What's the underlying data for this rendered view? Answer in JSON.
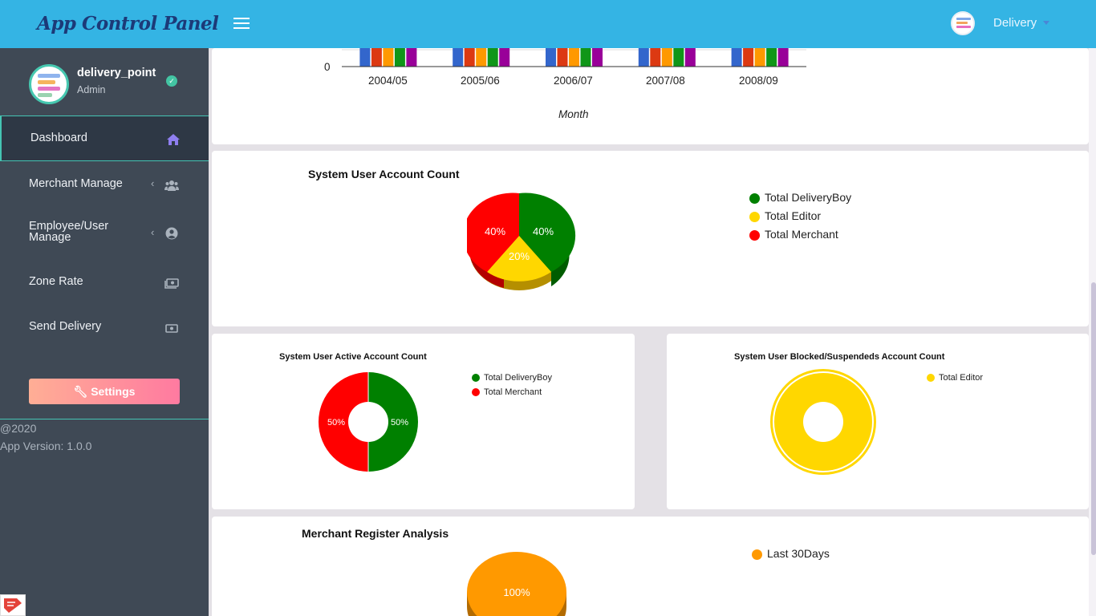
{
  "app": {
    "brand": "App Control Panel"
  },
  "header": {
    "user_name": "Delivery"
  },
  "profile": {
    "name": "delivery_point",
    "role": "Admin"
  },
  "sidebar": {
    "items": [
      {
        "label": "Dashboard",
        "icon": "home-icon",
        "active": true
      },
      {
        "label": "Merchant Manage",
        "icon": "users-icon",
        "expandable": true
      },
      {
        "label": "Employee/User Manage",
        "icon": "user-circle-icon",
        "expandable": true
      },
      {
        "label": "Zone Rate",
        "icon": "money-icon"
      },
      {
        "label": "Send Delivery",
        "icon": "money-icon"
      }
    ],
    "settings_label": "Settings",
    "settings_icon": "wrench-icon",
    "copyright": "@2020",
    "version": "App Version: 1.0.0"
  },
  "colors": {
    "topbar": "#34b4e4",
    "sidebar": "#3f4955",
    "accent_teal": "#45c4b3",
    "green": "#008000",
    "yellow": "#ffd700",
    "red": "#ff0000",
    "orange": "#ff9900"
  },
  "chart_data": [
    {
      "type": "bar",
      "title": "",
      "xlabel": "Month",
      "categories": [
        "2004/05",
        "2005/06",
        "2006/07",
        "2007/08",
        "2008/09"
      ],
      "y_ticks_visible": [
        "0"
      ],
      "series_colors": [
        "#3366cc",
        "#dc3912",
        "#ff9900",
        "#109618",
        "#990099"
      ],
      "note_visible_portion": "only bottom of bars visible (scrolled)"
    },
    {
      "type": "pie",
      "title": "System User Account Count",
      "three_d": true,
      "legend": "right",
      "slices": [
        {
          "name": "Total DeliveryBoy",
          "value": 40,
          "label": "40%",
          "color": "#008000"
        },
        {
          "name": "Total Editor",
          "value": 20,
          "label": "20%",
          "color": "#ffd700"
        },
        {
          "name": "Total Merchant",
          "value": 40,
          "label": "40%",
          "color": "#ff0000"
        }
      ]
    },
    {
      "type": "pie",
      "title": "System User Active Account Count",
      "donut": true,
      "legend": "right",
      "slices": [
        {
          "name": "Total DeliveryBoy",
          "value": 50,
          "label": "50%",
          "color": "#008000"
        },
        {
          "name": "Total Merchant",
          "value": 50,
          "label": "50%",
          "color": "#ff0000"
        }
      ]
    },
    {
      "type": "pie",
      "title": "System User Blocked/Suspendeds Account Count",
      "donut": true,
      "legend": "right",
      "slices": [
        {
          "name": "Total Editor",
          "value": 100,
          "label": "",
          "color": "#ffd700"
        }
      ]
    },
    {
      "type": "pie",
      "title": "Merchant Register Analysis",
      "three_d": true,
      "legend": "right",
      "slices": [
        {
          "name": "Last 30Days",
          "value": 100,
          "label": "100%",
          "color": "#ff9900"
        }
      ]
    }
  ]
}
